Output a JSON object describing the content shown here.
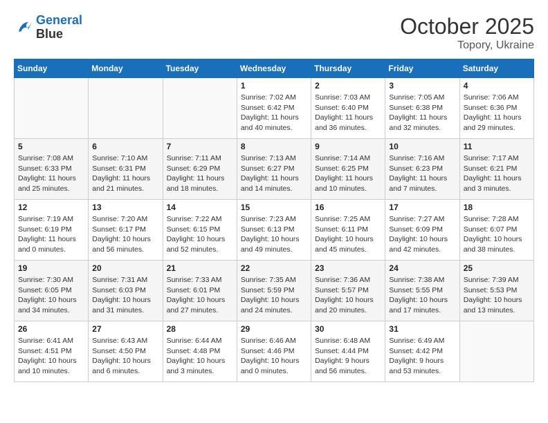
{
  "header": {
    "logo_line1": "General",
    "logo_line2": "Blue",
    "month": "October 2025",
    "location": "Topory, Ukraine"
  },
  "weekdays": [
    "Sunday",
    "Monday",
    "Tuesday",
    "Wednesday",
    "Thursday",
    "Friday",
    "Saturday"
  ],
  "weeks": [
    [
      {
        "day": "",
        "info": ""
      },
      {
        "day": "",
        "info": ""
      },
      {
        "day": "",
        "info": ""
      },
      {
        "day": "1",
        "info": "Sunrise: 7:02 AM\nSunset: 6:42 PM\nDaylight: 11 hours\nand 40 minutes."
      },
      {
        "day": "2",
        "info": "Sunrise: 7:03 AM\nSunset: 6:40 PM\nDaylight: 11 hours\nand 36 minutes."
      },
      {
        "day": "3",
        "info": "Sunrise: 7:05 AM\nSunset: 6:38 PM\nDaylight: 11 hours\nand 32 minutes."
      },
      {
        "day": "4",
        "info": "Sunrise: 7:06 AM\nSunset: 6:36 PM\nDaylight: 11 hours\nand 29 minutes."
      }
    ],
    [
      {
        "day": "5",
        "info": "Sunrise: 7:08 AM\nSunset: 6:33 PM\nDaylight: 11 hours\nand 25 minutes."
      },
      {
        "day": "6",
        "info": "Sunrise: 7:10 AM\nSunset: 6:31 PM\nDaylight: 11 hours\nand 21 minutes."
      },
      {
        "day": "7",
        "info": "Sunrise: 7:11 AM\nSunset: 6:29 PM\nDaylight: 11 hours\nand 18 minutes."
      },
      {
        "day": "8",
        "info": "Sunrise: 7:13 AM\nSunset: 6:27 PM\nDaylight: 11 hours\nand 14 minutes."
      },
      {
        "day": "9",
        "info": "Sunrise: 7:14 AM\nSunset: 6:25 PM\nDaylight: 11 hours\nand 10 minutes."
      },
      {
        "day": "10",
        "info": "Sunrise: 7:16 AM\nSunset: 6:23 PM\nDaylight: 11 hours\nand 7 minutes."
      },
      {
        "day": "11",
        "info": "Sunrise: 7:17 AM\nSunset: 6:21 PM\nDaylight: 11 hours\nand 3 minutes."
      }
    ],
    [
      {
        "day": "12",
        "info": "Sunrise: 7:19 AM\nSunset: 6:19 PM\nDaylight: 11 hours\nand 0 minutes."
      },
      {
        "day": "13",
        "info": "Sunrise: 7:20 AM\nSunset: 6:17 PM\nDaylight: 10 hours\nand 56 minutes."
      },
      {
        "day": "14",
        "info": "Sunrise: 7:22 AM\nSunset: 6:15 PM\nDaylight: 10 hours\nand 52 minutes."
      },
      {
        "day": "15",
        "info": "Sunrise: 7:23 AM\nSunset: 6:13 PM\nDaylight: 10 hours\nand 49 minutes."
      },
      {
        "day": "16",
        "info": "Sunrise: 7:25 AM\nSunset: 6:11 PM\nDaylight: 10 hours\nand 45 minutes."
      },
      {
        "day": "17",
        "info": "Sunrise: 7:27 AM\nSunset: 6:09 PM\nDaylight: 10 hours\nand 42 minutes."
      },
      {
        "day": "18",
        "info": "Sunrise: 7:28 AM\nSunset: 6:07 PM\nDaylight: 10 hours\nand 38 minutes."
      }
    ],
    [
      {
        "day": "19",
        "info": "Sunrise: 7:30 AM\nSunset: 6:05 PM\nDaylight: 10 hours\nand 34 minutes."
      },
      {
        "day": "20",
        "info": "Sunrise: 7:31 AM\nSunset: 6:03 PM\nDaylight: 10 hours\nand 31 minutes."
      },
      {
        "day": "21",
        "info": "Sunrise: 7:33 AM\nSunset: 6:01 PM\nDaylight: 10 hours\nand 27 minutes."
      },
      {
        "day": "22",
        "info": "Sunrise: 7:35 AM\nSunset: 5:59 PM\nDaylight: 10 hours\nand 24 minutes."
      },
      {
        "day": "23",
        "info": "Sunrise: 7:36 AM\nSunset: 5:57 PM\nDaylight: 10 hours\nand 20 minutes."
      },
      {
        "day": "24",
        "info": "Sunrise: 7:38 AM\nSunset: 5:55 PM\nDaylight: 10 hours\nand 17 minutes."
      },
      {
        "day": "25",
        "info": "Sunrise: 7:39 AM\nSunset: 5:53 PM\nDaylight: 10 hours\nand 13 minutes."
      }
    ],
    [
      {
        "day": "26",
        "info": "Sunrise: 6:41 AM\nSunset: 4:51 PM\nDaylight: 10 hours\nand 10 minutes."
      },
      {
        "day": "27",
        "info": "Sunrise: 6:43 AM\nSunset: 4:50 PM\nDaylight: 10 hours\nand 6 minutes."
      },
      {
        "day": "28",
        "info": "Sunrise: 6:44 AM\nSunset: 4:48 PM\nDaylight: 10 hours\nand 3 minutes."
      },
      {
        "day": "29",
        "info": "Sunrise: 6:46 AM\nSunset: 4:46 PM\nDaylight: 10 hours\nand 0 minutes."
      },
      {
        "day": "30",
        "info": "Sunrise: 6:48 AM\nSunset: 4:44 PM\nDaylight: 9 hours\nand 56 minutes."
      },
      {
        "day": "31",
        "info": "Sunrise: 6:49 AM\nSunset: 4:42 PM\nDaylight: 9 hours\nand 53 minutes."
      },
      {
        "day": "",
        "info": ""
      }
    ]
  ]
}
